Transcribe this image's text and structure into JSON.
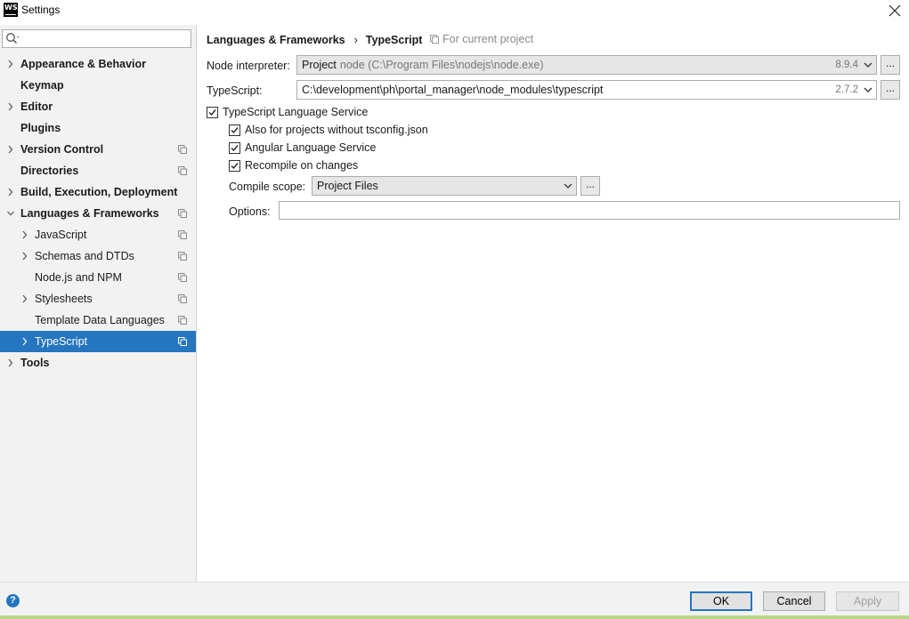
{
  "window": {
    "title": "Settings",
    "logo_text": "WS"
  },
  "search": {
    "placeholder": "",
    "value": ""
  },
  "sidebar": {
    "items": [
      {
        "label": "Appearance & Behavior",
        "level": 0,
        "bold": true,
        "chevron": "right",
        "project_icon": false,
        "selected": false
      },
      {
        "label": "Keymap",
        "level": 0,
        "bold": true,
        "chevron": "none",
        "project_icon": false,
        "selected": false
      },
      {
        "label": "Editor",
        "level": 0,
        "bold": true,
        "chevron": "right",
        "project_icon": false,
        "selected": false
      },
      {
        "label": "Plugins",
        "level": 0,
        "bold": true,
        "chevron": "none",
        "project_icon": false,
        "selected": false
      },
      {
        "label": "Version Control",
        "level": 0,
        "bold": true,
        "chevron": "right",
        "project_icon": true,
        "selected": false
      },
      {
        "label": "Directories",
        "level": 0,
        "bold": true,
        "chevron": "none",
        "project_icon": true,
        "selected": false
      },
      {
        "label": "Build, Execution, Deployment",
        "level": 0,
        "bold": true,
        "chevron": "right",
        "project_icon": false,
        "selected": false
      },
      {
        "label": "Languages & Frameworks",
        "level": 0,
        "bold": true,
        "chevron": "down",
        "project_icon": true,
        "selected": false
      },
      {
        "label": "JavaScript",
        "level": 1,
        "bold": false,
        "chevron": "right",
        "project_icon": true,
        "selected": false
      },
      {
        "label": "Schemas and DTDs",
        "level": 1,
        "bold": false,
        "chevron": "right",
        "project_icon": true,
        "selected": false
      },
      {
        "label": "Node.js and NPM",
        "level": 1,
        "bold": false,
        "chevron": "none",
        "project_icon": true,
        "selected": false
      },
      {
        "label": "Stylesheets",
        "level": 1,
        "bold": false,
        "chevron": "right",
        "project_icon": true,
        "selected": false
      },
      {
        "label": "Template Data Languages",
        "level": 1,
        "bold": false,
        "chevron": "none",
        "project_icon": true,
        "selected": false
      },
      {
        "label": "TypeScript",
        "level": 1,
        "bold": false,
        "chevron": "right",
        "project_icon": true,
        "selected": true
      },
      {
        "label": "Tools",
        "level": 0,
        "bold": true,
        "chevron": "right",
        "project_icon": false,
        "selected": false
      }
    ]
  },
  "breadcrumb": {
    "parent": "Languages & Frameworks",
    "separator": "›",
    "current": "TypeScript",
    "scope_note": "For current project"
  },
  "node_interpreter": {
    "label": "Node interpreter:",
    "kind": "Project",
    "path": "node (C:\\Program Files\\nodejs\\node.exe)",
    "version": "8.9.4",
    "browse_label": "..."
  },
  "typescript": {
    "label": "TypeScript:",
    "path": "C:\\development\\ph\\portal_manager\\node_modules\\typescript",
    "version": "2.7.2",
    "browse_label": "..."
  },
  "language_service": {
    "label": "TypeScript Language Service",
    "checked": true,
    "also_without_tsconfig": {
      "label": "Also for projects without tsconfig.json",
      "checked": true
    },
    "angular_service": {
      "label": "Angular Language Service",
      "checked": true
    },
    "recompile": {
      "label": "Recompile on changes",
      "checked": true
    }
  },
  "compile_scope": {
    "label": "Compile scope:",
    "value": "Project Files",
    "browse_label": "..."
  },
  "options": {
    "label": "Options:",
    "value": ""
  },
  "buttons": {
    "help": "?",
    "ok": "OK",
    "cancel": "Cancel",
    "apply": "Apply"
  },
  "colors": {
    "selection": "#2675bf",
    "sidebar_bg": "#f2f2f2",
    "status_strip": "#b8d78a"
  }
}
